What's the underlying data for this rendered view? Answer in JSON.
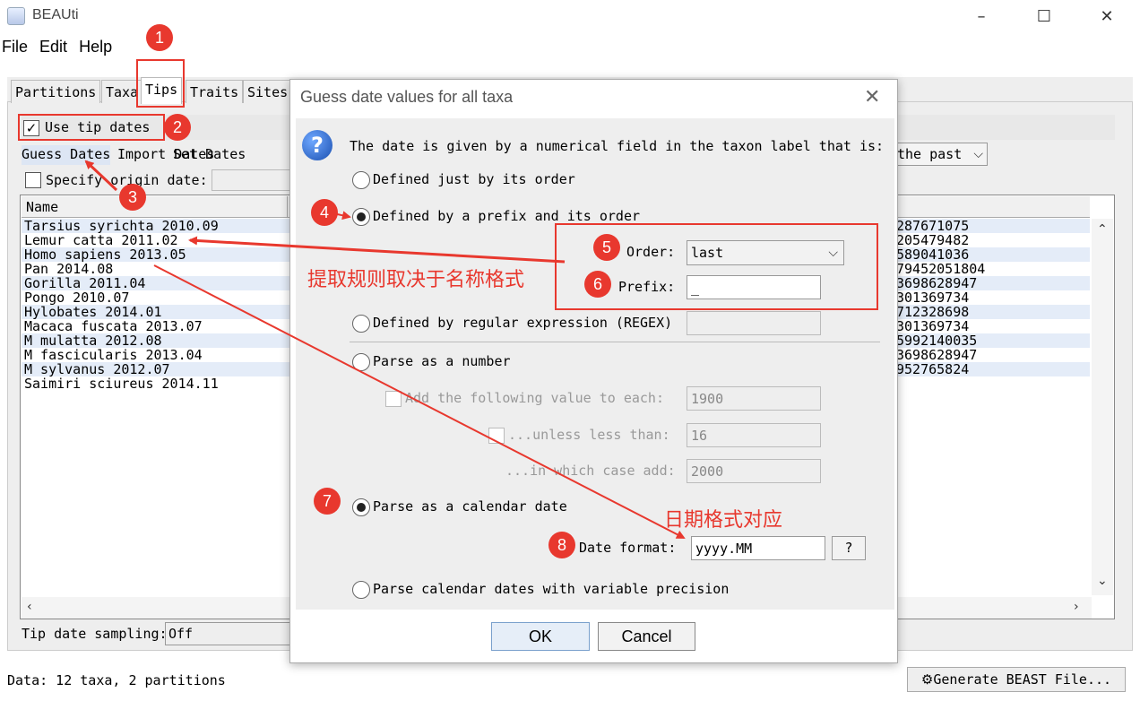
{
  "window": {
    "title": "BEAUti",
    "controls": [
      "–",
      "☐",
      "✕"
    ]
  },
  "menu": [
    "File",
    "Edit",
    "Help"
  ],
  "tabs": [
    {
      "label": "Partitions"
    },
    {
      "label": "Taxa"
    },
    {
      "label": "Tips"
    },
    {
      "label": "Traits"
    },
    {
      "label": "Sites"
    }
  ],
  "tips": {
    "use_tip_dates_label": "Use tip dates",
    "use_tip_dates_checked": true,
    "subtabs": [
      "Guess Dates",
      "Import Dates",
      "Set Dates"
    ],
    "specify_origin_label": "Specify origin date:",
    "direction_value": "the past",
    "table": {
      "column_name": "Name",
      "rows": [
        {
          "name": "Tarsius syrichta 2010.09",
          "value": "287671075"
        },
        {
          "name": "Lemur catta 2011.02",
          "value": "205479482"
        },
        {
          "name": "Homo sapiens 2013.05",
          "value": "589041036"
        },
        {
          "name": "Pan 2014.08",
          "value": "79452051804"
        },
        {
          "name": "Gorilla 2011.04",
          "value": "3698628947"
        },
        {
          "name": "Pongo 2010.07",
          "value": "301369734"
        },
        {
          "name": "Hylobates 2014.01",
          "value": "712328698"
        },
        {
          "name": "Macaca fuscata 2013.07",
          "value": "301369734"
        },
        {
          "name": "M mulatta 2012.08",
          "value": "5992140035"
        },
        {
          "name": "M fascicularis 2013.04",
          "value": "3698628947"
        },
        {
          "name": "M sylvanus 2012.07",
          "value": "952765824"
        },
        {
          "name": "Saimiri sciureus 2014.11",
          "value": ""
        }
      ]
    },
    "sampling_label": "Tip date sampling:",
    "sampling_value": "Off"
  },
  "status": {
    "text": "Data: 12 taxa, 2 partitions",
    "generate_button": "Generate BEAST File..."
  },
  "dialog": {
    "title": "Guess date values for all taxa",
    "question": "The date is given by a numerical field in the taxon label that is:",
    "opt_order": "Defined just by its order",
    "opt_prefix": "Defined by a prefix and its order",
    "order_label": "Order:",
    "order_value": "last",
    "prefix_label": "Prefix:",
    "prefix_value": "_",
    "opt_regex": "Defined by regular expression (REGEX)",
    "opt_number": "Parse as a number",
    "add_label": "Add the following value to each:",
    "add_value": "1900",
    "unless_label": "...unless less than:",
    "unless_value": "16",
    "case_label": "...in which case add:",
    "case_value": "2000",
    "opt_calendar": "Parse as a calendar date",
    "date_format_label": "Date format:",
    "date_format_value": "yyyy.MM",
    "help_button": "?",
    "opt_variable": "Parse calendar dates with variable precision",
    "ok": "OK",
    "cancel": "Cancel"
  },
  "annotations": {
    "badges": [
      "1",
      "2",
      "3",
      "4",
      "5",
      "6",
      "7",
      "8"
    ],
    "note_rule": "提取规则取决于名称格式",
    "note_format": "日期格式对应",
    "color": "#e8382e"
  }
}
